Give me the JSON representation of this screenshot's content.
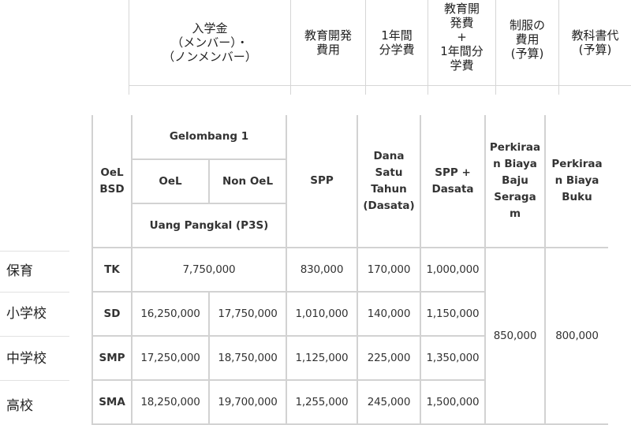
{
  "jp_header": {
    "columns": [
      "入学金\n（メンバー）・\n（ノンメンバー）",
      "教育開発\n費用",
      "1年間\n分学費",
      "教育開\n発費\n+\n1年間分\n学費",
      "制服の\n費用\n(予算)",
      "教科書代\n(予算)"
    ]
  },
  "table": {
    "h_oel_bsd": "OeL\nBSD",
    "h_gelombang": "Gelombang 1",
    "h_oel": "OeL",
    "h_non_oel": "Non OeL",
    "h_uang_pangkal": "Uang Pangkal (P3S)",
    "h_spp": "SPP",
    "h_dasata": "Dana\nSatu\nTahun\n(Dasata)",
    "h_spp_dasata": "SPP +\nDasata",
    "h_baju": "Perkiraa\nn Biaya\nBaju\nSeraga\nm",
    "h_buku": "Perkiraa\nn Biaya\nBuku",
    "rows": [
      {
        "level": "TK",
        "oel": "7,750,000",
        "spp": "830,000",
        "dasata": "170,000",
        "total": "1,000,000",
        "baju": "",
        "buku": ""
      },
      {
        "level": "SD",
        "oel": "16,250,000",
        "non_oel": "17,750,000",
        "spp": "1,010,000",
        "dasata": "140,000",
        "total": "1,150,000",
        "baju": "850,000",
        "buku": "800,000"
      },
      {
        "level": "SMP",
        "oel": "17,250,000",
        "non_oel": "18,750,000",
        "spp": "1,125,000",
        "dasata": "225,000",
        "total": "1,350,000",
        "baju": "",
        "buku": ""
      },
      {
        "level": "SMA",
        "oel": "18,250,000",
        "non_oel": "19,700,000",
        "spp": "1,255,000",
        "dasata": "245,000",
        "total": "1,500,000",
        "baju": "",
        "buku": ""
      }
    ]
  },
  "jp_levels": [
    "保育",
    "小学校",
    "中学校",
    "高校"
  ]
}
